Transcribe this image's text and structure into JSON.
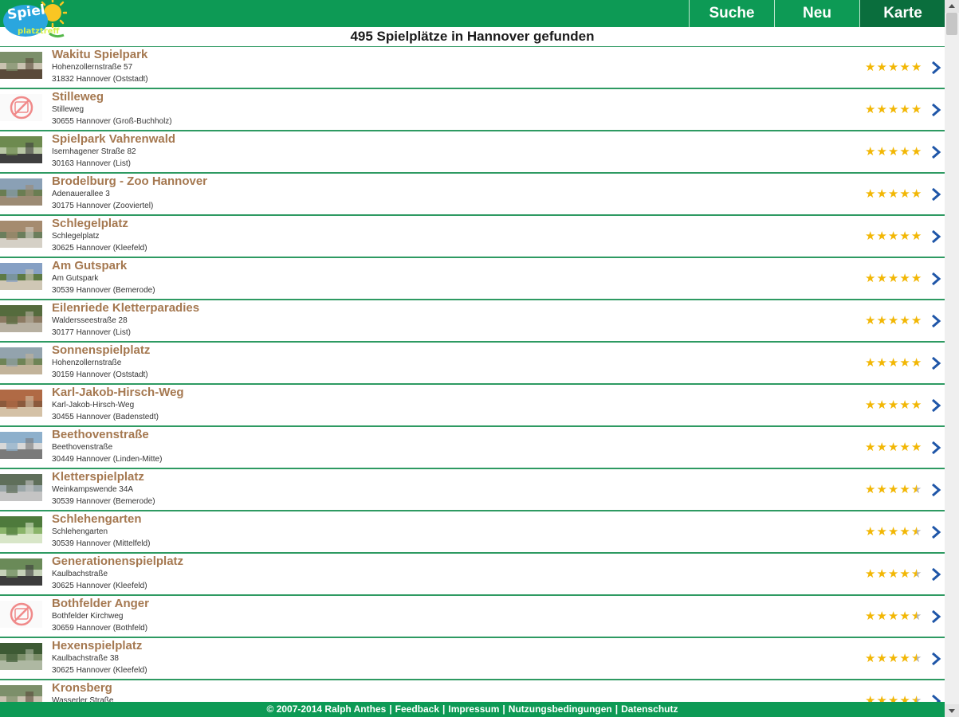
{
  "app": {
    "logo_text": "Spielplatztreff"
  },
  "nav": {
    "search": "Suche",
    "new": "Neu",
    "map": "Karte"
  },
  "results_title": "495 Spielplätze in Hannover gefunden",
  "colors": {
    "header_green": "#0d9a55",
    "active_tab": "#0a6e3d",
    "name_brown": "#a57850",
    "star_gold": "#f2b705",
    "chevron_blue": "#1f56a8"
  },
  "playgrounds": [
    {
      "name": "Wakitu Spielpark",
      "street": "Hohenzollernstraße 57",
      "city": "31832 Hannover (Oststadt)",
      "rating": 5,
      "thumb": "photo"
    },
    {
      "name": "Stilleweg",
      "street": "Stilleweg",
      "city": "30655 Hannover (Groß-Buchholz)",
      "rating": 5,
      "thumb": "no-photo"
    },
    {
      "name": "Spielpark Vahrenwald",
      "street": "Isernhagener Straße 82",
      "city": "30163 Hannover (List)",
      "rating": 5,
      "thumb": "photo"
    },
    {
      "name": "Brodelburg - Zoo Hannover",
      "street": "Adenauerallee 3",
      "city": "30175 Hannover (Zooviertel)",
      "rating": 5,
      "thumb": "photo"
    },
    {
      "name": "Schlegelplatz",
      "street": "Schlegelplatz",
      "city": "30625 Hannover (Kleefeld)",
      "rating": 5,
      "thumb": "photo"
    },
    {
      "name": "Am Gutspark",
      "street": "Am Gutspark",
      "city": "30539 Hannover (Bemerode)",
      "rating": 5,
      "thumb": "photo"
    },
    {
      "name": "Eilenriede Kletterparadies",
      "street": "Waldersseestraße 28",
      "city": "30177 Hannover (List)",
      "rating": 5,
      "thumb": "photo"
    },
    {
      "name": "Sonnenspielplatz",
      "street": "Hohenzollernstraße",
      "city": "30159 Hannover (Oststadt)",
      "rating": 5,
      "thumb": "photo"
    },
    {
      "name": "Karl-Jakob-Hirsch-Weg",
      "street": "Karl-Jakob-Hirsch-Weg",
      "city": "30455 Hannover (Badenstedt)",
      "rating": 5,
      "thumb": "photo"
    },
    {
      "name": "Beethovenstraße",
      "street": "Beethovenstraße",
      "city": "30449 Hannover (Linden-Mitte)",
      "rating": 5,
      "thumb": "photo"
    },
    {
      "name": "Kletterspielplatz",
      "street": "Weinkampswende 34A",
      "city": "30539 Hannover (Bemerode)",
      "rating": 4.5,
      "thumb": "photo"
    },
    {
      "name": "Schlehengarten",
      "street": "Schlehengarten",
      "city": "30539 Hannover (Mittelfeld)",
      "rating": 4.5,
      "thumb": "photo"
    },
    {
      "name": "Generationenspielplatz",
      "street": "Kaulbachstraße",
      "city": "30625 Hannover (Kleefeld)",
      "rating": 4.5,
      "thumb": "photo"
    },
    {
      "name": "Bothfelder Anger",
      "street": "Bothfelder Kirchweg",
      "city": "30659 Hannover (Bothfeld)",
      "rating": 4.5,
      "thumb": "no-photo"
    },
    {
      "name": "Hexenspielplatz",
      "street": "Kaulbachstraße 38",
      "city": "30625 Hannover (Kleefeld)",
      "rating": 4.5,
      "thumb": "photo"
    },
    {
      "name": "Kronsberg",
      "street": "Wasserler Straße",
      "city": "",
      "rating": 4.5,
      "thumb": "photo"
    }
  ],
  "footer": {
    "copyright": "© 2007-2014 Ralph Anthes",
    "links": [
      "Feedback",
      "Impressum",
      "Nutzungsbedingungen",
      "Datenschutz"
    ]
  }
}
